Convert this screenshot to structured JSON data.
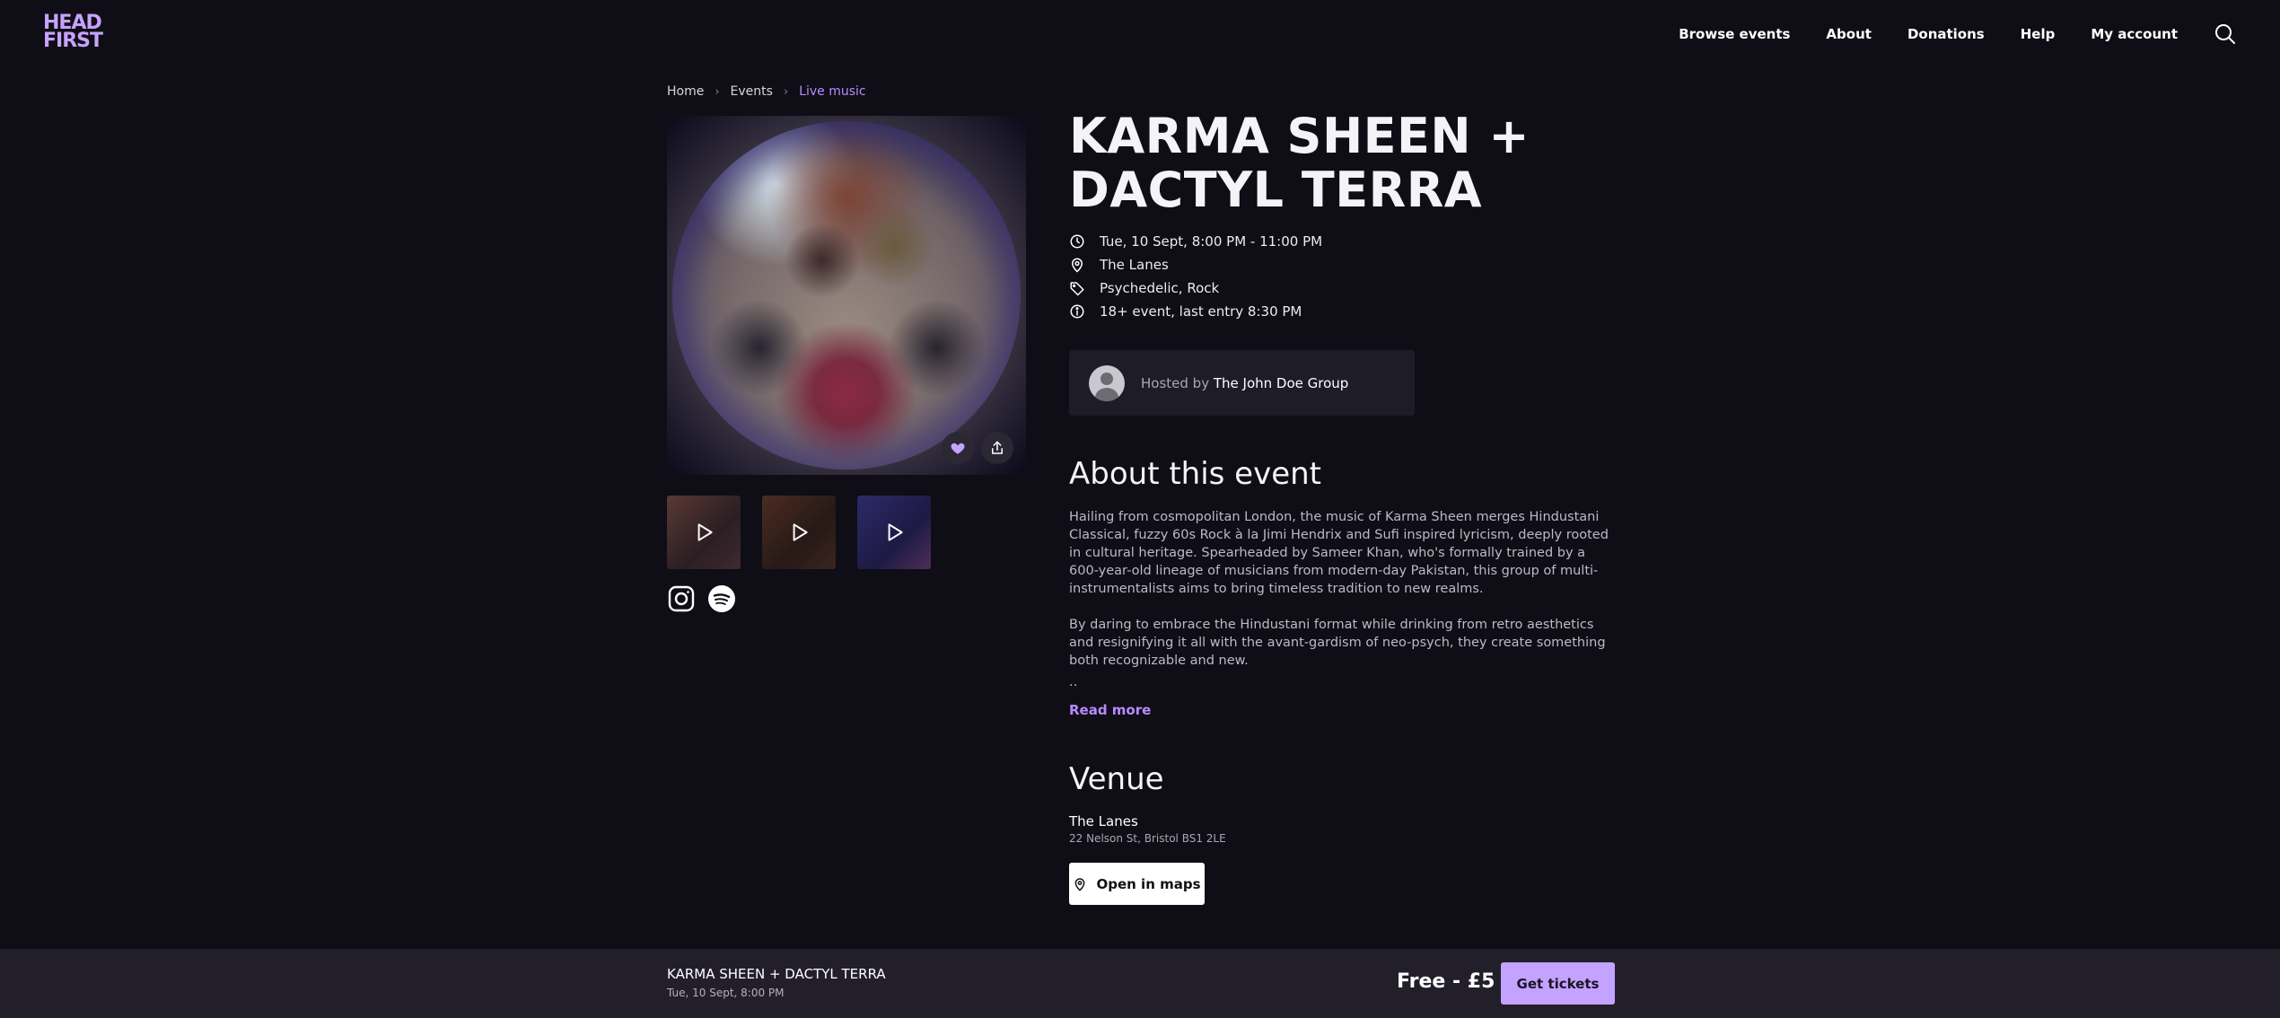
{
  "logo": {
    "line1": "HEAD",
    "line2": "FIRST"
  },
  "nav": {
    "items": [
      "Browse events",
      "About",
      "Donations",
      "Help",
      "My account"
    ],
    "search_icon": "search-icon"
  },
  "breadcrumb": {
    "items": [
      "Home",
      "Events"
    ],
    "current": "Live music",
    "separator": "›"
  },
  "event": {
    "title": "KARMA SHEEN + DACTYL TERRA",
    "datetime": "Tue, 10 Sept, 8:00 PM - 11:00 PM",
    "venue": "The Lanes",
    "genres": "Psychedelic, Rock",
    "age_info": "18+ event, last entry 8:30 PM"
  },
  "host": {
    "prefix": "Hosted by",
    "name": "The John Doe Group"
  },
  "about": {
    "heading": "About this event",
    "paragraphs": [
      "Hailing from cosmopolitan London, the music of Karma Sheen merges Hindustani Classical, fuzzy 60s Rock à la Jimi Hendrix and Sufi inspired lyricism, deeply rooted in cultural heritage. Spearheaded by Sameer Khan, who's formally trained by a 600-year-old lineage of musicians from modern-day Pakistan, this group of multi-instrumentalists aims to bring timeless tradition to new realms.",
      "By daring to embrace the Hindustani format while drinking from retro aesthetics and resignifying it all with the avant-gardism of neo-psych, they create something both recognizable and new."
    ],
    "truncation": "..",
    "read_more": "Read more"
  },
  "venue": {
    "heading": "Venue",
    "name": "The Lanes",
    "address": "22 Nelson St, Bristol BS1 2LE",
    "maps_label": "Open in maps"
  },
  "bottom_bar": {
    "title": "KARMA SHEEN + DACTYL TERRA",
    "date": "Tue, 10 Sept, 8:00 PM",
    "price": "Free - £5",
    "cta": "Get tickets"
  },
  "icons": {
    "hero_like": "heart-icon",
    "hero_share": "share-icon",
    "socials": [
      "instagram-icon",
      "spotify-icon"
    ]
  },
  "colors": {
    "background": "#0f0d15",
    "accent": "#b98bff",
    "cta": "#c4a2ff",
    "panel": "#1e1c26",
    "bottom_bar": "#221f2b"
  }
}
